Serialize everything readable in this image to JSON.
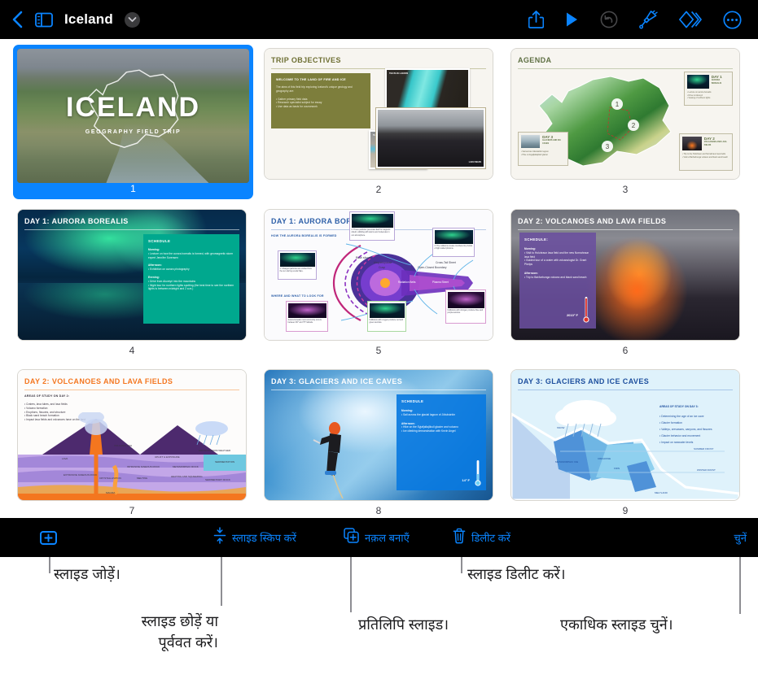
{
  "navbar": {
    "back_icon": "chevron-left-icon",
    "sidebar_icon": "sidebar-toggle-icon",
    "title": "Iceland",
    "title_chevron_icon": "chevron-down-icon",
    "actions": [
      {
        "name": "share-button",
        "icon": "share-icon",
        "enabled": true
      },
      {
        "name": "play-button",
        "icon": "play-icon",
        "enabled": true
      },
      {
        "name": "undo-button",
        "icon": "undo-icon",
        "enabled": false
      },
      {
        "name": "format-button",
        "icon": "paintbrush-icon",
        "enabled": true
      },
      {
        "name": "animate-button",
        "icon": "animate-diamonds-icon",
        "enabled": true
      },
      {
        "name": "more-button",
        "icon": "ellipsis-circle-icon",
        "enabled": true
      }
    ],
    "background": "#000000",
    "accent": "#0a84ff",
    "disabled_color": "#48484a"
  },
  "slides": [
    {
      "number": "1",
      "selected": true,
      "kind": "title",
      "title": "ICELAND",
      "subtitle": "GEOGRAPHY FIELD TRIP"
    },
    {
      "number": "2",
      "selected": false,
      "kind": "objectives",
      "title": "TRIP OBJECTIVES",
      "box_heading": "WELCOME TO THE LAND OF FIRE AND ICE",
      "box_intro": "The aims of this field trip exploring Iceland's unique geology and geography are:",
      "box_bullets": [
        "Gather primary field data",
        "Research specialist subject for essay",
        "Use data as basis for coursework"
      ],
      "photo_labels": [
        "THE BLUE LAGOON",
        "THE GEYSIR AND NEARBY GEOTHERMAL AREA",
        "LAVA FIELDS"
      ]
    },
    {
      "number": "3",
      "selected": false,
      "kind": "agenda",
      "title": "AGENDA",
      "markers": [
        "1",
        "2",
        "3"
      ],
      "cards": [
        {
          "day": "DAY 1",
          "subject": "AURORA BOREALIS",
          "bullets": [
            "Lecture on aurora borealis",
            "Drive to Akureyri",
            "Viewing of northern lights"
          ]
        },
        {
          "day": "DAY 2",
          "subject": "VOLCANOES AND LAVA FIELDS",
          "bullets": [
            "Trip to the Holuhraun and Nornahraun lava fields",
            "Visit to Barðarbunga volcano and black sand beach"
          ]
        },
        {
          "day": "DAY 3",
          "subject": "GLACIERS AND ICE CAVES",
          "bullets": [
            "Sail across Jökulsárlón lagoon",
            "Hike on Eyjafjallajökull glacier"
          ]
        }
      ]
    },
    {
      "number": "4",
      "selected": false,
      "kind": "schedule-aurora",
      "title": "DAY 1: AURORA BOREALIS",
      "box_heading": "SCHEDULE",
      "sections": [
        {
          "label": "Morning:",
          "bullets": [
            "Lecture on how the aurora borealis is formed, with geomagnetic storm expert Jennifer Sorensen"
          ]
        },
        {
          "label": "Afternoon:",
          "bullets": [
            "Exhibition on aurora photography"
          ]
        },
        {
          "label": "Evening:",
          "bullets": [
            "Drive from Akureyri into the mountains",
            "Night tour for northern lights spotting (the best time to see the northern lights is between midnight and 2 a.m.)"
          ]
        }
      ]
    },
    {
      "number": "5",
      "selected": false,
      "kind": "diagram-magnetosphere",
      "title": "DAY 1: AURORA BOREALIS",
      "heading_1": "HOW THE AURORA BOREALIS IS FORMED",
      "heading_2": "WHERE AND WHAT TO LOOK FOR",
      "callouts": [
        "1. Charged particles are emitted from the sun during a solar flare.",
        "2. These particles penetrate Earth's magnetic shield, colliding with atoms and molecules in our atmosphere.",
        "3. The collisions create countless tiny bursts of light called photons.",
        "Aurora borealis most commonly occurs between 60° and 75° latitude.",
        "Collisions with oxygen produce red and green auroras.",
        "Collisions with nitrogen produce blue and purple auroras."
      ],
      "diagram_labels": [
        "Bow shock",
        "Magnetopause",
        "Cusp",
        "Open-Closed Boundary",
        "Radiation Belts and Ring Current",
        "Plasma Sheet",
        "Cross-Tail Sheet",
        "Auroral Oval",
        "Lobes"
      ]
    },
    {
      "number": "6",
      "selected": false,
      "kind": "schedule-volcano",
      "title": "DAY 2: VOLCANOES AND LAVA FIELDS",
      "box_heading": "SCHEDULE:",
      "sections": [
        {
          "label": "Morning:",
          "bullets": [
            "Visit to Holuhraun lava field and the new Nornahraun lava field",
            "Guided tour of a crater with volcanologist Dr. Grant Phelps"
          ]
        },
        {
          "label": "Afternoon:",
          "bullets": [
            "Trip to Bárðarbunga volcano and black sand beach"
          ]
        }
      ],
      "temperature": "2010° F"
    },
    {
      "number": "7",
      "selected": false,
      "kind": "diagram-volcano",
      "title": "DAY 2: VOLCANOES AND LAVA FIELDS",
      "heading": "AREAS OF STUDY ON DAY 2:",
      "bullets": [
        "Craters, lava tubes, and lava fields",
        "Volcano formation",
        "Eruptions, fissures, and structure",
        "Black sand beach formation",
        "Impact lava fields and volcanoes have on the land"
      ],
      "diagram_labels": [
        "VOLCANIC ASH",
        "LAVA",
        "UPLIFT & EXPOSURE",
        "EROSION FROM WEATHER",
        "SEDIMENTATION",
        "INTRUSIVE IGNEOUS ROCK",
        "METAMORPHIC ROCK",
        "EXTRUSIVE IGNEOUS ROCK",
        "CRYSTALLIZATION",
        "MELTING",
        "HEATING AND SQUEEZING",
        "SEDIMENTARY ROCK",
        "MAGMA"
      ]
    },
    {
      "number": "8",
      "selected": false,
      "kind": "schedule-glacier",
      "title": "DAY 3: GLACIERS AND ICE CAVES",
      "box_heading": "SCHEDULE",
      "sections": [
        {
          "label": "Morning:",
          "bullets": [
            "Sail across the glacial lagoon of Jökulsárlón"
          ]
        },
        {
          "label": "Afternoon:",
          "bullets": [
            "Hike on the Eyjafjallajökull glacier and volcano",
            "Ice climbing demonstration with Kevin Angel"
          ]
        }
      ],
      "temperature": "14° F"
    },
    {
      "number": "9",
      "selected": false,
      "kind": "diagram-glacier",
      "title": "DAY 3: GLACIERS AND ICE CAVES",
      "heading": "AREAS OF STUDY ON DAY 3:",
      "bullets": [
        "Determining the age of an ice cave",
        "Glacier formation",
        "Valleys, crevasses, canyons, and fissures",
        "Glacier behavior and movement",
        "Impact on seawater levels"
      ],
      "diagram_labels": [
        "SNOW",
        "METAMORPHIC ICE",
        "SUMMER FROST",
        "WINTER FROST",
        "FIRN",
        "CREVASSE",
        "MELTLAND"
      ]
    }
  ],
  "bottom_toolbar": {
    "add_slide": {
      "icon": "plus-box-icon",
      "label": ""
    },
    "skip_slide": {
      "icon": "collapse-arrows-icon",
      "label": "स्लाइड स्किप करें"
    },
    "duplicate": {
      "icon": "duplicate-icon",
      "label": "नक़ल बनाएँ"
    },
    "delete": {
      "icon": "trash-icon",
      "label": "डिलीट करें"
    },
    "select": {
      "icon": "",
      "label": "चुनें"
    }
  },
  "callouts": [
    {
      "name": "callout-add-slide",
      "text": "स्लाइड जोड़ें।"
    },
    {
      "name": "callout-skip-slide",
      "text_line1": "स्लाइड छोड़ें या",
      "text_line2": "पूर्ववत करें।"
    },
    {
      "name": "callout-duplicate-slide",
      "text": "प्रतिलिपि स्लाइड।"
    },
    {
      "name": "callout-delete-slide",
      "text": "स्लाइड डिलीट करें।"
    },
    {
      "name": "callout-select-multiple",
      "text": "एकाधिक स्लाइड चुनें।"
    }
  ],
  "colors": {
    "accent_blue": "#0a84ff",
    "bar_black": "#000000",
    "leader_gray": "#8e8e93",
    "slide_cream": "#f7f5f0",
    "olive": "#7d7e3c",
    "teal": "#00a88e",
    "purple": "#6a4f9e",
    "ice_blue": "#0a7ae0",
    "orange": "#f4761f"
  }
}
